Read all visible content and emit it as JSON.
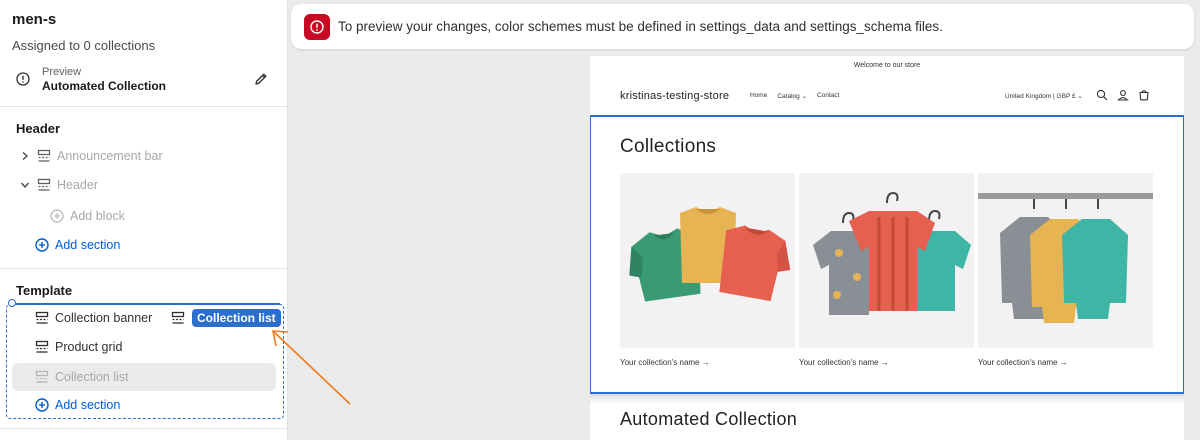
{
  "sidebar": {
    "title": "men-s",
    "assigned": "Assigned to 0 collections",
    "preview_label": "Preview",
    "preview_value": "Automated Collection",
    "header_group": "Header",
    "header_items": [
      {
        "label": "Announcement bar"
      },
      {
        "label": "Header"
      }
    ],
    "add_block": "Add block",
    "add_section": "Add section",
    "template_group": "Template",
    "template_items": [
      {
        "label": "Collection banner"
      },
      {
        "label": "Product grid"
      },
      {
        "label": "Collection list"
      }
    ],
    "drag_chip": "Collection list"
  },
  "banner": {
    "message": "To preview your changes, color schemes must be defined in settings_data and settings_schema files."
  },
  "store": {
    "announcement": "Welcome to our store",
    "name": "kristinas-testing-store",
    "nav": [
      "Home",
      "Catalog",
      "Contact"
    ],
    "region": "United Kingdom | GBP £",
    "section_title": "Collections",
    "collections": [
      {
        "label": "Your collection's name →"
      },
      {
        "label": "Your collection's name →"
      },
      {
        "label": "Your collection's name →"
      }
    ],
    "next_title": "Automated Collection"
  },
  "colors": {
    "accent": "#2c6ecb",
    "error": "#c70a24",
    "arrow": "#f07a1a"
  }
}
